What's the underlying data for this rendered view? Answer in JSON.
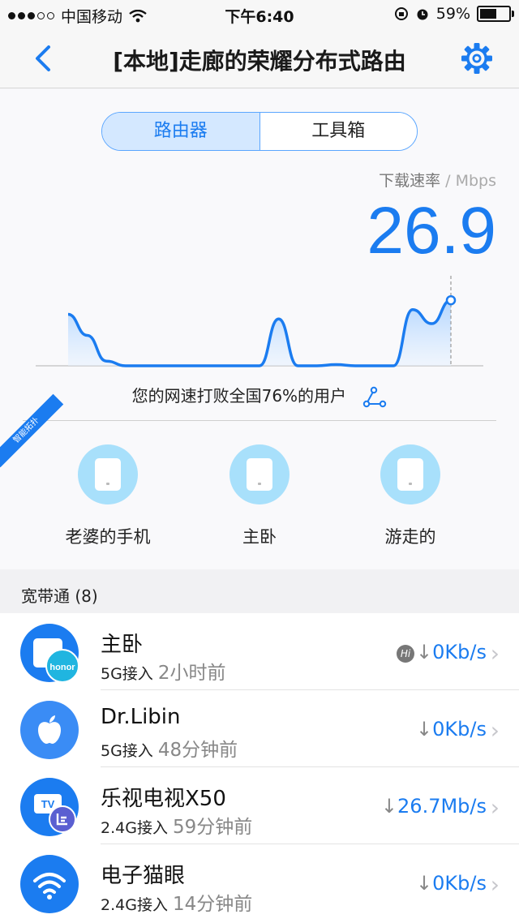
{
  "status_bar": {
    "carrier": "中国移动",
    "time": "下午6:40",
    "battery": "59%"
  },
  "nav": {
    "title": "[本地]走廊的荣耀分布式路由"
  },
  "tabs": [
    {
      "label": "路由器",
      "active": true
    },
    {
      "label": "工具箱",
      "active": false
    }
  ],
  "speed": {
    "label": "下载速率",
    "unit": " / Mbps",
    "value": "26.9"
  },
  "chart_data": {
    "type": "area",
    "x": [
      0,
      1,
      2,
      3,
      4,
      5,
      6,
      7,
      8,
      9,
      10,
      11,
      12,
      13,
      14,
      15,
      16,
      17,
      18,
      19,
      20
    ],
    "values": [
      22,
      13,
      2,
      0,
      0,
      0,
      0,
      0,
      0,
      0,
      0,
      20,
      0,
      0,
      0.5,
      0,
      0,
      0,
      24,
      18,
      28
    ],
    "ylim": [
      0,
      35
    ]
  },
  "beat_text": "您的网速打败全国76%的用户",
  "ribbon_text": "智能拓扑",
  "nodes": [
    {
      "name": "老婆的手机"
    },
    {
      "name": "主卧"
    },
    {
      "name": "游走的"
    }
  ],
  "section": {
    "title": "宽带通 (8)"
  },
  "devices": [
    {
      "name": "主卧",
      "band": "5G接入",
      "ago": "2小时前",
      "rate": "0Kb/s",
      "icon": "honor-router-icon",
      "badge": "honor",
      "hi": "Hi"
    },
    {
      "name": "Dr.Libin",
      "band": "5G接入",
      "ago": "48分钟前",
      "rate": "0Kb/s",
      "icon": "apple-icon"
    },
    {
      "name": "乐视电视X50",
      "band": "2.4G接入",
      "ago": "59分钟前",
      "rate": "26.7Mb/s",
      "icon": "tv-icon",
      "tv_text": "TV"
    },
    {
      "name": "电子猫眼",
      "band": "2.4G接入",
      "ago": "14分钟前",
      "rate": "0Kb/s",
      "icon": "wifi-icon"
    }
  ],
  "colors": {
    "accent": "#1b7cf0",
    "node_circle": "#a8e0fb"
  }
}
